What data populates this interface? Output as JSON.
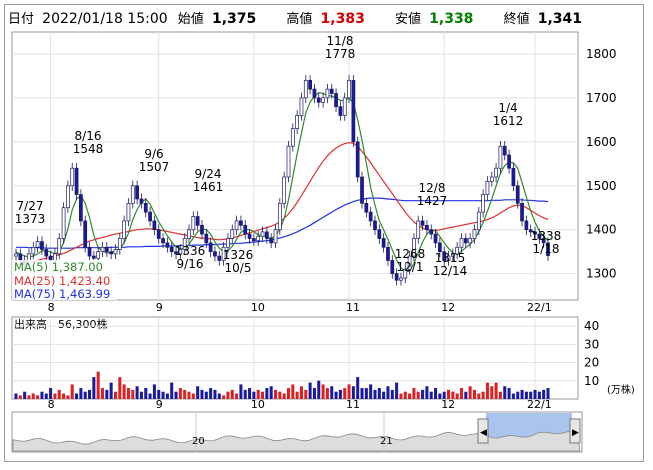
{
  "header": {
    "date_label": "日付",
    "datetime": "2022/01/18 15:00",
    "open_label": "始値",
    "open": "1,375",
    "high_label": "高値",
    "high": "1,383",
    "low_label": "安値",
    "low": "1,338",
    "close_label": "終値",
    "close": "1,341"
  },
  "legend": {
    "ma5": "MA(5)    1,387.00",
    "ma25": "MA(25)  1,423.40",
    "ma75": "MA(75)  1,463.99"
  },
  "volume_label": "出来高　56,300株",
  "volume_unit": "(万株)",
  "colors": {
    "up": "#ffffff",
    "down": "#1a1aa0",
    "ma5": "#2e8b2e",
    "ma25": "#e03030",
    "ma75": "#2030e0",
    "vol_up": "#e02020",
    "vol_down": "#1a1aa0",
    "high": "#d00000",
    "low": "#008000"
  },
  "chart_data": [
    {
      "type": "candlestick",
      "title": "",
      "x_tick_labels": [
        "8",
        "9",
        "10",
        "11",
        "12",
        "22/1"
      ],
      "y_ticks": [
        1300,
        1400,
        1500,
        1600,
        1700,
        1800
      ],
      "ylim": [
        1240,
        1850
      ],
      "grid": true,
      "annotations": [
        {
          "text": "7/27\n1373",
          "date": "7/27",
          "value": 1373
        },
        {
          "text": "8/16\n1548",
          "date": "8/16",
          "value": 1548
        },
        {
          "text": "9/6\n1507",
          "date": "9/6",
          "value": 1507
        },
        {
          "text": "1336\n9/16",
          "date": "9/16",
          "value": 1336
        },
        {
          "text": "9/24\n1461",
          "date": "9/24",
          "value": 1461
        },
        {
          "text": "1326\n10/5",
          "date": "10/5",
          "value": 1326
        },
        {
          "text": "11/8\n1778",
          "date": "11/8",
          "value": 1778
        },
        {
          "text": "12/8\n1427",
          "date": "12/8",
          "value": 1427
        },
        {
          "text": "1268\n12/1",
          "date": "12/1",
          "value": 1268
        },
        {
          "text": "1315\n12/14",
          "date": "12/14",
          "value": 1315
        },
        {
          "text": "1/4\n1612",
          "date": "1/4",
          "value": 1612
        },
        {
          "text": "1338\n1/18",
          "date": "1/18",
          "value": 1338
        }
      ],
      "closes": [
        1345,
        1330,
        1320,
        1345,
        1360,
        1373,
        1355,
        1340,
        1330,
        1345,
        1380,
        1450,
        1500,
        1540,
        1480,
        1420,
        1360,
        1340,
        1335,
        1350,
        1360,
        1350,
        1345,
        1355,
        1380,
        1420,
        1460,
        1500,
        1470,
        1460,
        1440,
        1420,
        1400,
        1380,
        1370,
        1360,
        1350,
        1345,
        1355,
        1380,
        1400,
        1430,
        1410,
        1390,
        1370,
        1350,
        1340,
        1330,
        1360,
        1380,
        1400,
        1420,
        1410,
        1390,
        1380,
        1375,
        1385,
        1395,
        1380,
        1370,
        1400,
        1460,
        1520,
        1590,
        1630,
        1660,
        1700,
        1740,
        1720,
        1700,
        1690,
        1700,
        1720,
        1710,
        1680,
        1660,
        1700,
        1740,
        1600,
        1520,
        1460,
        1440,
        1420,
        1400,
        1380,
        1360,
        1330,
        1300,
        1285,
        1290,
        1310,
        1340,
        1380,
        1420,
        1410,
        1400,
        1390,
        1370,
        1350,
        1330,
        1340,
        1345,
        1360,
        1380,
        1370,
        1380,
        1400,
        1440,
        1480,
        1510,
        1520,
        1540,
        1590,
        1570,
        1540,
        1500,
        1460,
        1420,
        1400,
        1395,
        1390,
        1380,
        1370,
        1341
      ],
      "ma5": [
        1349,
        1345,
        1340,
        1338,
        1340,
        1345,
        1352,
        1352,
        1350,
        1345,
        1350,
        1370,
        1402,
        1445,
        1470,
        1478,
        1460,
        1428,
        1387,
        1359,
        1351,
        1347,
        1348,
        1352,
        1357,
        1370,
        1392,
        1423,
        1446,
        1462,
        1470,
        1458,
        1438,
        1418,
        1402,
        1386,
        1372,
        1361,
        1356,
        1358,
        1366,
        1382,
        1395,
        1402,
        1400,
        1390,
        1372,
        1358,
        1350,
        1352,
        1362,
        1378,
        1394,
        1400,
        1400,
        1396,
        1388,
        1387,
        1383,
        1381,
        1386,
        1401,
        1425,
        1468,
        1520,
        1572,
        1620,
        1666,
        1690,
        1704,
        1712,
        1710,
        1706,
        1704,
        1700,
        1694,
        1694,
        1700,
        1688,
        1650,
        1604,
        1552,
        1496,
        1456,
        1420,
        1400,
        1378,
        1354,
        1331,
        1313,
        1305,
        1305,
        1323,
        1348,
        1372,
        1390,
        1400,
        1398,
        1384,
        1370,
        1358,
        1347,
        1343,
        1351,
        1359,
        1367,
        1378,
        1396,
        1416,
        1442,
        1470,
        1500,
        1528,
        1546,
        1554,
        1552,
        1540,
        1508,
        1474,
        1443,
        1417,
        1397,
        1385,
        1375
      ],
      "ma25": [
        1320,
        1322,
        1323,
        1325,
        1327,
        1330,
        1333,
        1335,
        1337,
        1340,
        1343,
        1346,
        1350,
        1355,
        1360,
        1365,
        1370,
        1374,
        1377,
        1380,
        1382,
        1385,
        1388,
        1390,
        1392,
        1394,
        1396,
        1398,
        1400,
        1401,
        1402,
        1402,
        1401,
        1400,
        1398,
        1396,
        1394,
        1392,
        1390,
        1388,
        1386,
        1384,
        1382,
        1381,
        1380,
        1379,
        1378,
        1377,
        1378,
        1379,
        1381,
        1384,
        1387,
        1390,
        1393,
        1396,
        1399,
        1402,
        1405,
        1408,
        1412,
        1418,
        1426,
        1436,
        1448,
        1462,
        1478,
        1494,
        1510,
        1526,
        1542,
        1556,
        1568,
        1578,
        1586,
        1592,
        1596,
        1598,
        1597,
        1590,
        1578,
        1566,
        1552,
        1538,
        1524,
        1510,
        1496,
        1482,
        1468,
        1454,
        1440,
        1428,
        1418,
        1410,
        1404,
        1400,
        1398,
        1398,
        1400,
        1402,
        1404,
        1406,
        1408,
        1410,
        1412,
        1414,
        1416,
        1418,
        1420,
        1423,
        1427,
        1432,
        1438,
        1444,
        1450,
        1454,
        1456,
        1455,
        1450,
        1444,
        1438,
        1432,
        1427,
        1423
      ],
      "ma75": [
        1360,
        1360,
        1360,
        1359,
        1359,
        1359,
        1359,
        1358,
        1358,
        1358,
        1358,
        1358,
        1358,
        1358,
        1359,
        1359,
        1359,
        1359,
        1359,
        1359,
        1359,
        1359,
        1360,
        1360,
        1360,
        1360,
        1361,
        1361,
        1361,
        1361,
        1362,
        1362,
        1362,
        1362,
        1363,
        1363,
        1363,
        1363,
        1364,
        1364,
        1364,
        1365,
        1365,
        1365,
        1366,
        1366,
        1366,
        1367,
        1367,
        1368,
        1368,
        1369,
        1369,
        1370,
        1371,
        1372,
        1373,
        1374,
        1375,
        1377,
        1379,
        1381,
        1384,
        1387,
        1391,
        1395,
        1400,
        1405,
        1410,
        1416,
        1422,
        1428,
        1434,
        1440,
        1446,
        1451,
        1456,
        1460,
        1464,
        1467,
        1469,
        1471,
        1472,
        1472,
        1472,
        1471,
        1470,
        1469,
        1468,
        1467,
        1466,
        1466,
        1466,
        1466,
        1466,
        1466,
        1466,
        1466,
        1466,
        1466,
        1466,
        1466,
        1466,
        1466,
        1466,
        1466,
        1466,
        1466,
        1466,
        1466,
        1467,
        1467,
        1467,
        1468,
        1468,
        1468,
        1468,
        1468,
        1467,
        1467,
        1466,
        1465,
        1465,
        1464
      ]
    },
    {
      "type": "bar",
      "title": "出来高",
      "y_ticks": [
        10,
        20,
        30,
        40
      ],
      "ylim": [
        0,
        45
      ],
      "unit": "(万株)",
      "x_tick_labels": [
        "8",
        "9",
        "10",
        "11",
        "12",
        "22/1"
      ],
      "values": [
        3,
        2,
        4,
        2,
        3,
        2,
        4,
        3,
        6,
        3,
        5,
        3,
        2,
        8,
        3,
        6,
        4,
        5,
        12,
        15,
        6,
        5,
        9,
        4,
        12,
        8,
        6,
        5,
        7,
        4,
        6,
        3,
        8,
        5,
        4,
        3,
        9,
        4,
        6,
        5,
        4,
        3,
        7,
        5,
        4,
        6,
        5,
        3,
        2,
        4,
        5,
        3,
        8,
        5,
        6,
        4,
        5,
        4,
        6,
        7,
        5,
        4,
        3,
        6,
        8,
        4,
        7,
        5,
        9,
        6,
        10,
        8,
        6,
        7,
        4,
        5,
        6,
        8,
        7,
        12,
        6,
        6,
        8,
        5,
        6,
        4,
        7,
        5,
        9,
        3,
        4,
        3,
        6,
        4,
        5,
        7,
        4,
        6,
        3,
        4,
        5,
        4,
        3,
        6,
        4,
        7,
        5,
        3,
        4,
        9,
        7,
        9,
        4,
        7,
        6,
        3,
        4,
        5,
        4,
        4,
        5,
        4,
        5,
        6
      ],
      "up": [
        0,
        1,
        0,
        1,
        1,
        1,
        0,
        0,
        0,
        1,
        1,
        1,
        1,
        1,
        0,
        0,
        0,
        0,
        0,
        1,
        1,
        0,
        0,
        1,
        1,
        1,
        1,
        1,
        0,
        0,
        0,
        0,
        0,
        0,
        0,
        0,
        0,
        0,
        1,
        1,
        1,
        1,
        0,
        0,
        0,
        0,
        0,
        0,
        1,
        1,
        1,
        1,
        0,
        0,
        0,
        0,
        1,
        1,
        0,
        0,
        1,
        1,
        1,
        1,
        1,
        1,
        1,
        1,
        0,
        0,
        0,
        1,
        1,
        0,
        0,
        0,
        1,
        1,
        0,
        0,
        0,
        0,
        0,
        0,
        0,
        0,
        0,
        0,
        0,
        1,
        1,
        1,
        1,
        1,
        0,
        0,
        0,
        0,
        0,
        0,
        1,
        1,
        1,
        1,
        0,
        1,
        1,
        1,
        1,
        1,
        1,
        1,
        1,
        0,
        0,
        0,
        0,
        0,
        0,
        0,
        0,
        0,
        0,
        0
      ]
    },
    {
      "type": "area",
      "title": "navigator",
      "x_tick_labels": [
        "20",
        "21"
      ]
    }
  ]
}
